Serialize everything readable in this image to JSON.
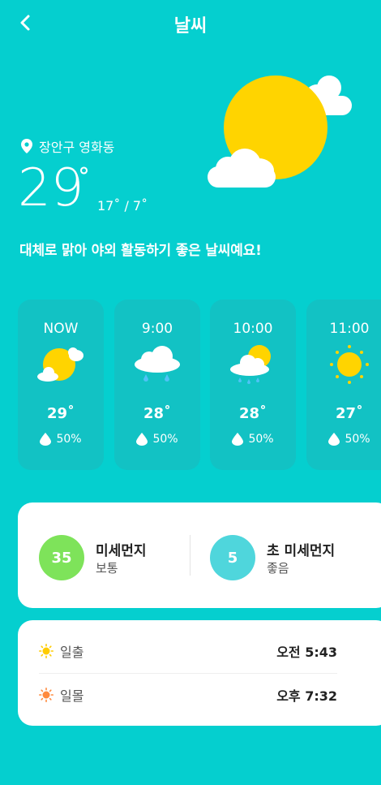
{
  "header": {
    "title": "날씨"
  },
  "location": "장안구 영화동",
  "current": {
    "temp": "29",
    "range": "17˚ / 7˚"
  },
  "summary": "대체로 맑아 야외 활동하기 좋은 날씨예요!",
  "hourly": [
    {
      "time": "NOW",
      "temp": "29˚",
      "rain": "50%",
      "icon": "partly-cloudy-icon"
    },
    {
      "time": "9:00",
      "temp": "28˚",
      "rain": "50%",
      "icon": "rain-cloud-icon"
    },
    {
      "time": "10:00",
      "temp": "28˚",
      "rain": "50%",
      "icon": "sun-rain-icon"
    },
    {
      "time": "11:00",
      "temp": "27˚",
      "rain": "50%",
      "icon": "sun-icon"
    }
  ],
  "dust": {
    "pm10": {
      "value": "35",
      "name": "미세먼지",
      "status": "보통",
      "color": "#7ee35a"
    },
    "pm25": {
      "value": "5",
      "name": "초 미세먼지",
      "status": "좋음",
      "color": "#4fd6dc"
    }
  },
  "sun": {
    "sunrise": {
      "label": "일출",
      "time": "오전 5:43"
    },
    "sunset": {
      "label": "일몰",
      "time": "오후 7:32"
    }
  },
  "colors": {
    "background": "#05cfcf",
    "card": "#12c2c4",
    "sun": "#ffd400"
  }
}
